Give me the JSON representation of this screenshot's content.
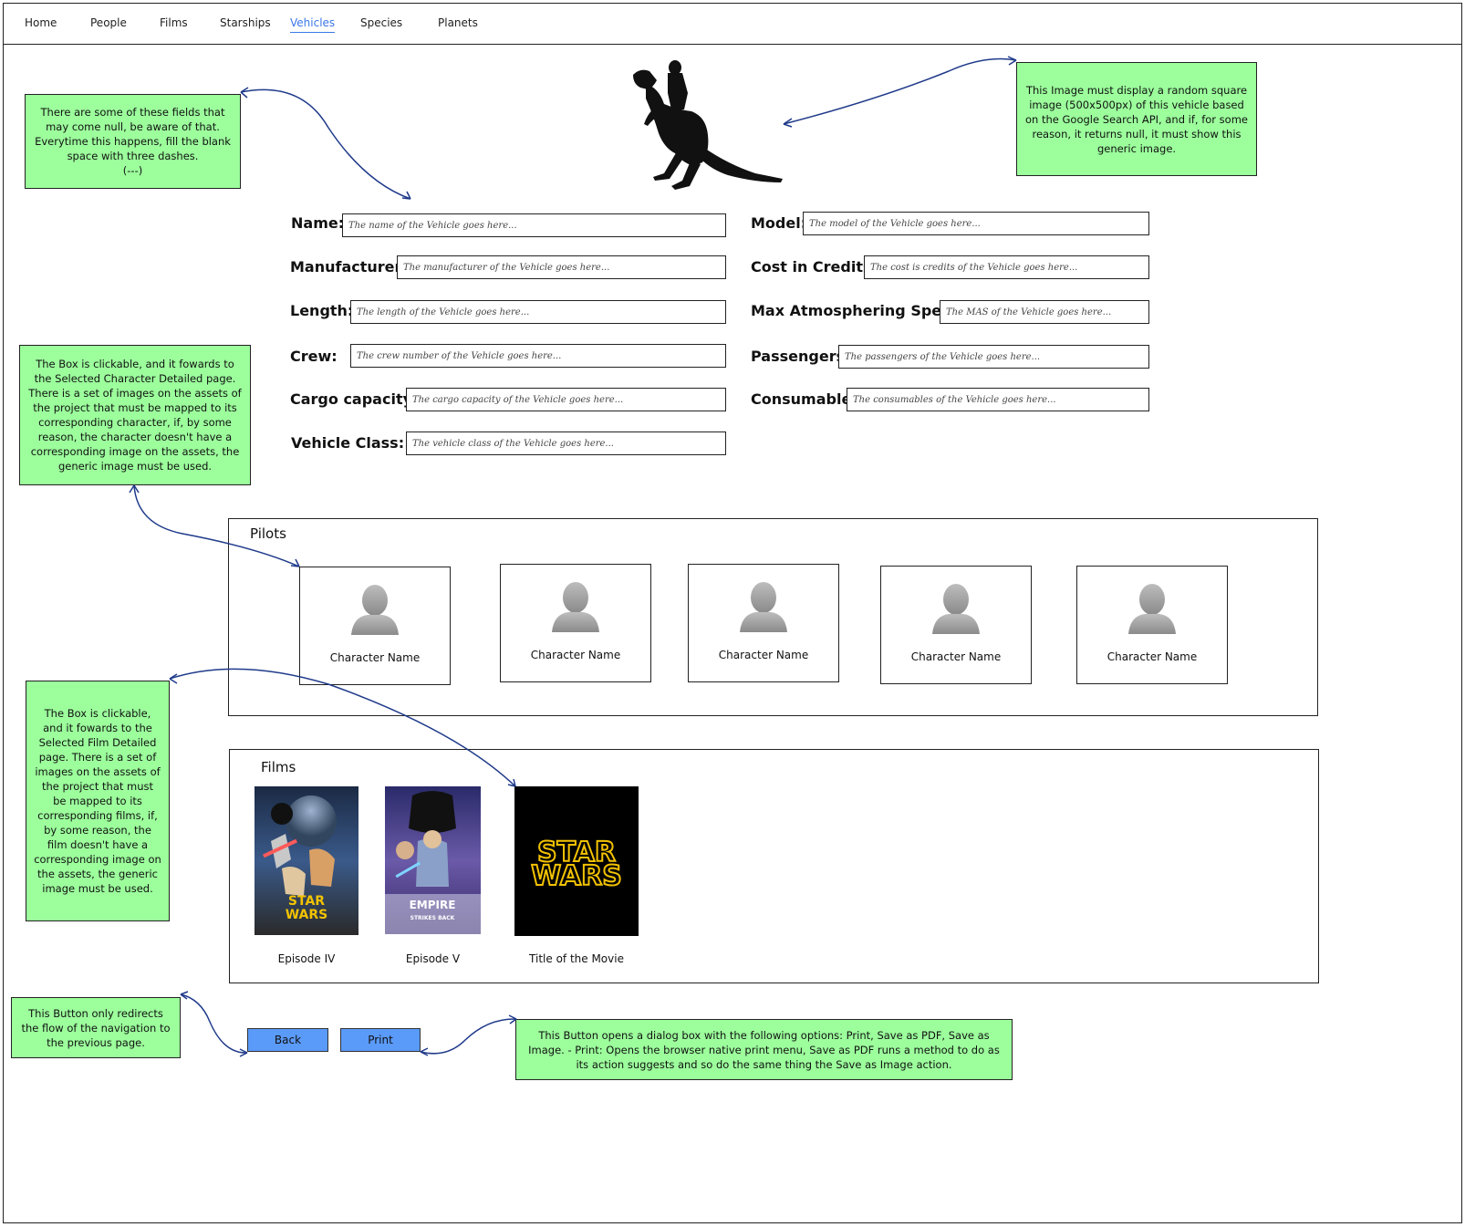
{
  "nav": {
    "items": [
      {
        "label": "Home"
      },
      {
        "label": "People"
      },
      {
        "label": "Films"
      },
      {
        "label": "Starships"
      },
      {
        "label": "Vehicles",
        "active": true
      },
      {
        "label": "Species"
      },
      {
        "label": "Planets"
      }
    ]
  },
  "notes": {
    "null_fields": "There are some of these fields that may come null, be aware of that. Everytime this happens, fill the blank space with three dashes.\n(---)",
    "image": "This Image must display a random square image (500x500px) of this vehicle based on the Google Search API, and if, for some reason, it returns null, it must show this generic image.",
    "pilots_box": "The Box is clickable, and it fowards to the Selected Character Detailed page. There is a set of images on the assets of the project that must be mapped to its corresponding character, if, by some reason, the character doesn't have a corresponding image on the assets, the generic image must be used.",
    "films_box": "The Box is clickable, and it fowards to the Selected Film Detailed page. There is a set of images on the assets of the project that must be mapped to its corresponding films, if, by some reason, the film doesn't have a corresponding image on the assets, the generic image must be used.",
    "back_button": "This Button only redirects the flow of the navigation to the previous page.",
    "print_button": "This Button opens a dialog box with the following options: Print, Save as PDF, Save as Image. - Print: Opens the browser native print menu, Save as PDF runs a method to do as its action suggests and so do the same thing the Save as Image action."
  },
  "fields": {
    "name": {
      "label": "Name:",
      "placeholder": "The name of the Vehicle goes here..."
    },
    "model": {
      "label": "Model:",
      "placeholder": "The model of the Vehicle goes here..."
    },
    "manufacturer": {
      "label": "Manufacturer:",
      "placeholder": "The manufacturer of the Vehicle goes here..."
    },
    "cost": {
      "label": "Cost in Credits:",
      "placeholder": "The cost is credits of the Vehicle goes here..."
    },
    "length": {
      "label": "Length:",
      "placeholder": "The length of the Vehicle goes here..."
    },
    "mas": {
      "label": "Max Atmosphering Speed:",
      "placeholder": "The MAS of the Vehicle goes here..."
    },
    "crew": {
      "label": "Crew:",
      "placeholder": "The crew number of the Vehicle goes here..."
    },
    "passengers": {
      "label": "Passengers:",
      "placeholder": "The passengers of the Vehicle goes here..."
    },
    "cargo": {
      "label": "Cargo capacity:",
      "placeholder": "The cargo capacity of the Vehicle goes here..."
    },
    "consumables": {
      "label": "Consumables:",
      "placeholder": "The consumables of the Vehicle goes here..."
    },
    "vclass": {
      "label": "Vehicle Class:",
      "placeholder": "The vehicle class of the Vehicle goes here..."
    }
  },
  "pilots": {
    "title": "Pilots",
    "characters": [
      {
        "name": "Character Name"
      },
      {
        "name": "Character Name"
      },
      {
        "name": "Character Name"
      },
      {
        "name": "Character Name"
      },
      {
        "name": "Character Name"
      }
    ]
  },
  "films": {
    "title": "Films",
    "items": [
      {
        "title": "Episode IV",
        "poster_text": "STAR WARS"
      },
      {
        "title": "Episode V",
        "poster_text": "EMPIRE STRIKES BACK"
      },
      {
        "title": "Title of the Movie",
        "poster_text": "STAR WARS"
      }
    ]
  },
  "buttons": {
    "back": "Back",
    "print": "Print"
  },
  "colors": {
    "note_bg": "#9cff9c",
    "button_bg": "#5a9af8",
    "active_nav": "#3b78e7",
    "arrow": "#1f3a8a"
  }
}
